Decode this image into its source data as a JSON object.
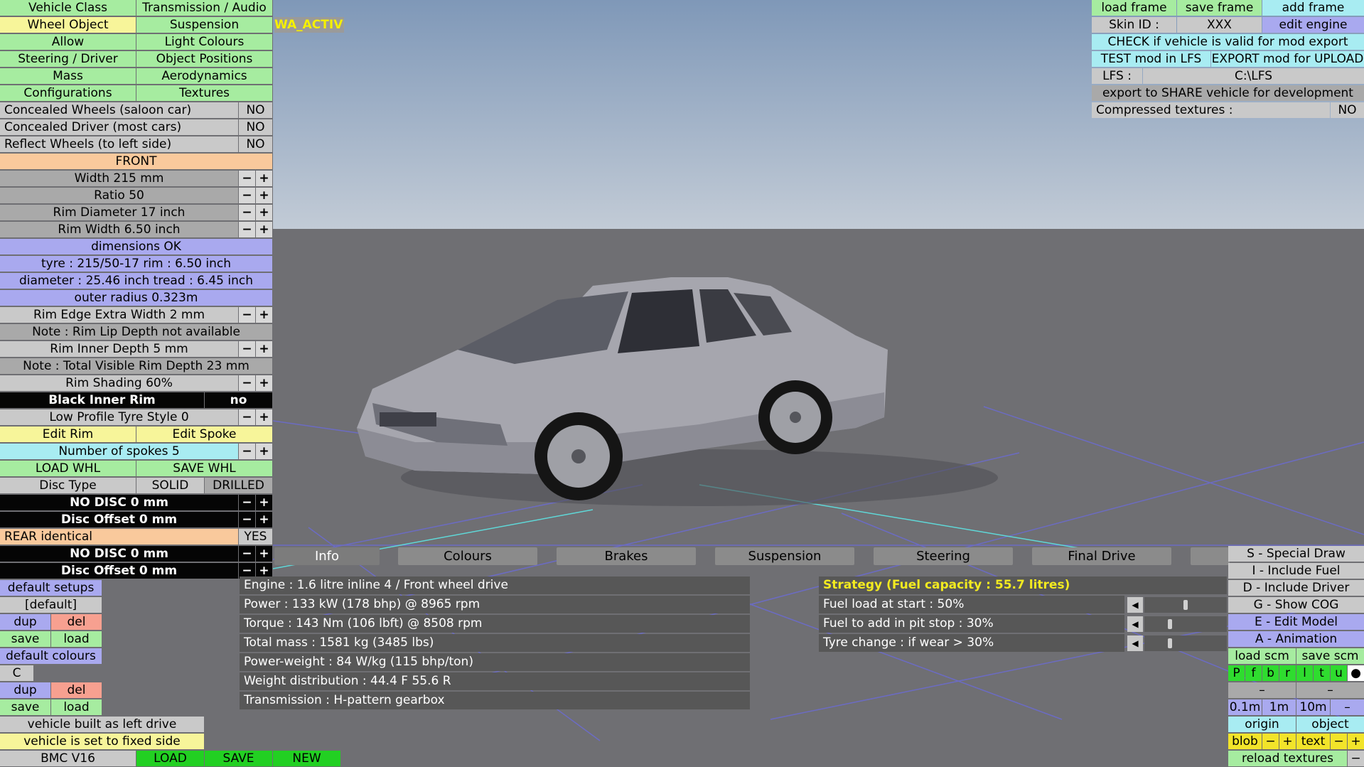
{
  "colors": {
    "green": "#a6eca0",
    "yellow": "#f7f59a",
    "blue": "#a9a9ef",
    "cyan": "#a8ecf2",
    "orange": "#f9c99c",
    "sky_top": "#7f98b8"
  },
  "left": {
    "vehicle_class": "Vehicle Class",
    "transmission_audio": "Transmission / Audio",
    "wheel_object": "Wheel Object",
    "suspension": "Suspension",
    "wa_active": "WA_ACTIVE",
    "allow": "Allow",
    "light_colours": "Light Colours",
    "steering_driver": "Steering / Driver",
    "object_positions": "Object Positions",
    "mass": "Mass",
    "aerodynamics": "Aerodynamics",
    "configurations": "Configurations",
    "textures": "Textures",
    "concealed_wheels": "Concealed Wheels (saloon car)",
    "concealed_wheels_val": "NO",
    "concealed_driver": "Concealed Driver (most cars)",
    "concealed_driver_val": "NO",
    "reflect_wheels": "Reflect Wheels (to left side)",
    "reflect_wheels_val": "NO",
    "front": "FRONT",
    "width": "Width 215 mm",
    "ratio": "Ratio 50",
    "rim_diameter": "Rim Diameter 17 inch",
    "rim_width": "Rim Width 6.50 inch",
    "dimensions_ok": "dimensions OK",
    "tyre_rim": "tyre : 215/50-17   rim : 6.50 inch",
    "diameter_tread": "diameter : 25.46 inch   tread : 6.45 inch",
    "outer_radius": "outer radius 0.323m",
    "rim_edge": "Rim Edge Extra Width 2 mm",
    "note_lip": "Note : Rim Lip Depth not available",
    "rim_inner": "Rim Inner Depth 5 mm",
    "note_visible": "Note : Total Visible Rim Depth 23 mm",
    "rim_shading": "Rim Shading 60%",
    "black_inner_rim": "Black Inner Rim",
    "black_inner_rim_val": "no",
    "low_profile": "Low Profile Tyre Style 0",
    "edit_rim": "Edit Rim",
    "edit_spoke": "Edit Spoke",
    "spokes": "Number of spokes 5",
    "load_whl": "LOAD WHL",
    "save_whl": "SAVE WHL",
    "disc_type": "Disc Type",
    "solid": "SOLID",
    "drilled": "DRILLED",
    "no_disc_front": "NO DISC 0 mm",
    "disc_offset_front": "Disc Offset 0 mm",
    "rear_identical": "REAR identical",
    "rear_identical_val": "YES",
    "no_disc_rear": "NO DISC 0 mm",
    "disc_offset_rear": "Disc Offset 0 mm",
    "minus": "−",
    "plus": "+"
  },
  "setups": {
    "default_setups": "default setups",
    "default": "[default]",
    "dup": "dup",
    "del": "del",
    "save": "save",
    "load": "load",
    "default_colours": "default colours",
    "c": "C",
    "built_left": "vehicle built as left drive",
    "fixed_side": "vehicle is set to fixed side",
    "engine": "BMC V16",
    "load_btn": "LOAD",
    "save_btn": "SAVE",
    "new_btn": "NEW"
  },
  "top_right": {
    "load_frame": "load frame",
    "save_frame": "save frame",
    "add_frame": "add frame",
    "skin_id_label": "Skin ID :",
    "skin_id": "XXX",
    "edit_engine": "edit engine",
    "check_valid": "CHECK if vehicle is valid for mod export",
    "test_mod": "TEST mod in LFS",
    "export_mod": "EXPORT mod for UPLOAD",
    "lfs_label": "LFS :",
    "lfs_path": "C:\\LFS",
    "export_share": "export to SHARE vehicle for development",
    "compressed_label": "Compressed textures :",
    "compressed_val": "NO"
  },
  "tabs": [
    "Info",
    "Colours",
    "Brakes",
    "Suspension",
    "Steering",
    "Final Drive"
  ],
  "info": [
    "Engine : 1.6 litre inline 4 / Front wheel drive",
    "Power : 133 kW (178 bhp) @ 8965 rpm",
    "Torque : 143 Nm (106 lbft) @ 8508 rpm",
    "Total mass : 1581 kg (3485 lbs)",
    "Power-weight : 84 W/kg (115 bhp/ton)",
    "Weight distribution : 44.4 F  55.6 R",
    "Transmission : H-pattern gearbox"
  ],
  "strategy": {
    "title": "Strategy (Fuel capacity : 55.7 litres)",
    "fuel_start": "Fuel load at start : 50%",
    "fuel_pit": "Fuel to add in pit stop : 30%",
    "tyre_change": "Tyre change : if wear > 30%",
    "fuel_start_level": 0.5,
    "fuel_pit_level": 0.3,
    "tyre_level": 0.3
  },
  "bottom_right": {
    "special_draw": "S - Special Draw",
    "include_fuel": "I - Include Fuel",
    "show_cog": "G - Show COG",
    "edit_model": "E - Edit Model",
    "animation": "A - Animation",
    "load_scm": "load scm",
    "save_scm": "save scm",
    "letters": [
      "P",
      "f",
      "b",
      "r",
      "l",
      "t",
      "u",
      "●"
    ],
    "dash1": "–",
    "dash2": "–",
    "step_01": "0.1m",
    "step_1": "1m",
    "step_10": "10m",
    "step_minus": "–",
    "origin": "origin",
    "object": "object",
    "blob": "blob",
    "text": "text",
    "minus": "−",
    "plus": "+",
    "reload_textures": "reload textures"
  }
}
